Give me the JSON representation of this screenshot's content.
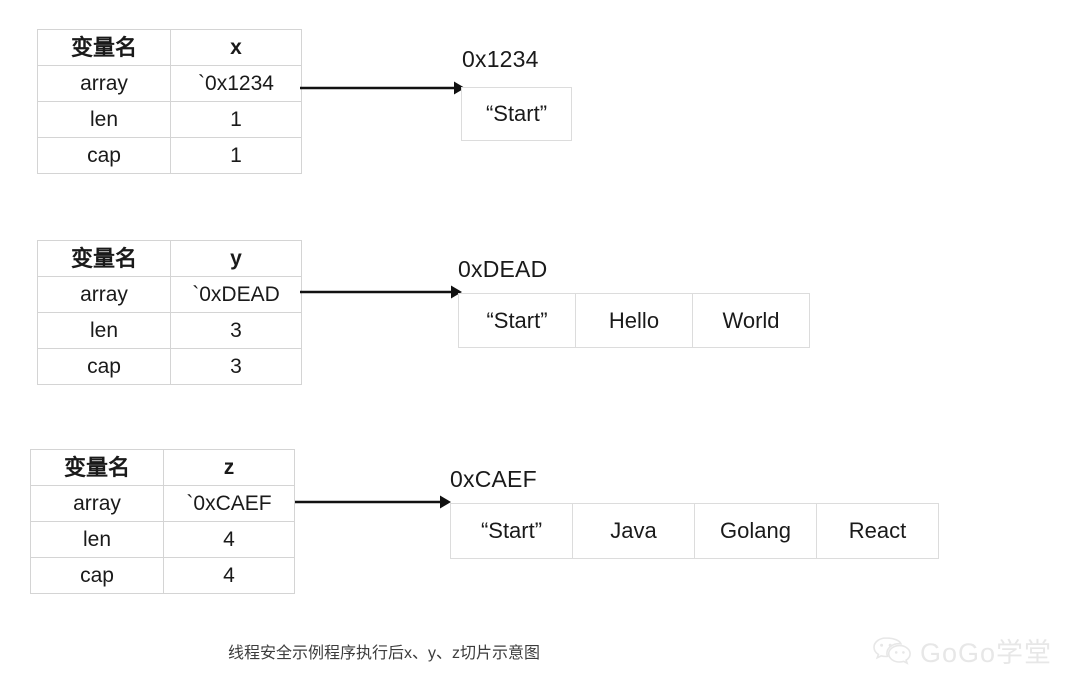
{
  "diagram": {
    "caption": "线程安全示例程序执行后x、y、z切片示意图",
    "row_label_header": "变量名",
    "field_labels": {
      "array": "array",
      "len": "len",
      "cap": "cap"
    },
    "groups": [
      {
        "var_name": "x",
        "array_value": "`0x1234",
        "len": "1",
        "cap": "1",
        "address_label": "0x1234",
        "cells": [
          "“Start”"
        ]
      },
      {
        "var_name": "y",
        "array_value": "`0xDEAD",
        "len": "3",
        "cap": "3",
        "address_label": "0xDEAD",
        "cells": [
          "“Start”",
          "Hello",
          "World"
        ]
      },
      {
        "var_name": "z",
        "array_value": "`0xCAEF",
        "len": "4",
        "cap": "4",
        "address_label": "0xCAEF",
        "cells": [
          "“Start”",
          "Java",
          "Golang",
          "React"
        ]
      }
    ]
  },
  "watermark": {
    "text": "GoGo学堂",
    "icon": "wechat-icon",
    "color": "#d2d2d2"
  },
  "colors": {
    "table_border": "#d4d4d4",
    "box_border": "#dcdcdc",
    "text": "#1a1a1a",
    "arrow": "#111111",
    "caption": "#3c3c3c"
  }
}
